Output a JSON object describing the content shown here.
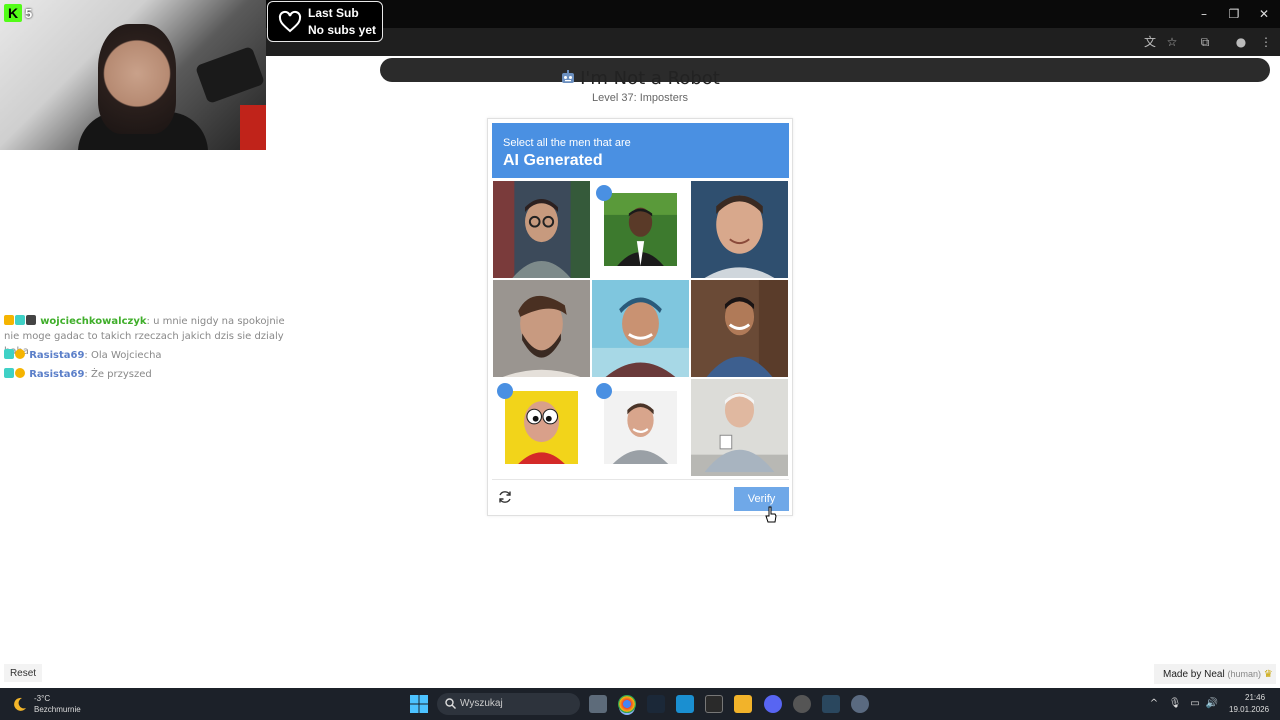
{
  "stream": {
    "viewer_count": "5",
    "last_sub": {
      "title": "Last Sub",
      "value": "No subs yet"
    }
  },
  "chat": [
    {
      "user": "wojciechkowalczyk",
      "message": "u mnie nigdy na spokojnie nie moge gadac to takich rzeczach jakich dzis sie dzialy haha",
      "user_color": "#3fae2a"
    },
    {
      "user": "Rasista69",
      "message": "Ola Wojciecha",
      "user_color": "#5b7fc9"
    },
    {
      "user": "Rasista69",
      "message": "Że przyszed",
      "user_color": "#5b7fc9"
    }
  ],
  "page": {
    "title": "I'm Not a Robot",
    "subtitle": "Level 37: Imposters"
  },
  "captcha": {
    "prompt": "Select all the men that are",
    "target": "AI Generated",
    "verify_label": "Verify",
    "tiles": [
      {
        "subject": "man with glasses",
        "selected": false
      },
      {
        "subject": "man in suit",
        "selected": true
      },
      {
        "subject": "man smiling",
        "selected": false
      },
      {
        "subject": "bearded man",
        "selected": false
      },
      {
        "subject": "man in cap",
        "selected": false
      },
      {
        "subject": "man in denim jacket",
        "selected": false
      },
      {
        "subject": "googly eyes man",
        "selected": true
      },
      {
        "subject": "man in grey tee",
        "selected": true
      },
      {
        "subject": "old man with mug",
        "selected": false
      }
    ]
  },
  "footer": {
    "reset_label": "Reset",
    "made_by": "Made by Neal",
    "made_by_note": "(human)"
  },
  "taskbar": {
    "temperature": "-3°C",
    "weather": "Bezchmurnie",
    "search_placeholder": "Wyszukaj",
    "time": "21:46",
    "date": "19.01.2026"
  },
  "colors": {
    "accent": "#4a90e2",
    "verify": "#6fa8e8",
    "taskbar": "#1c2129"
  }
}
